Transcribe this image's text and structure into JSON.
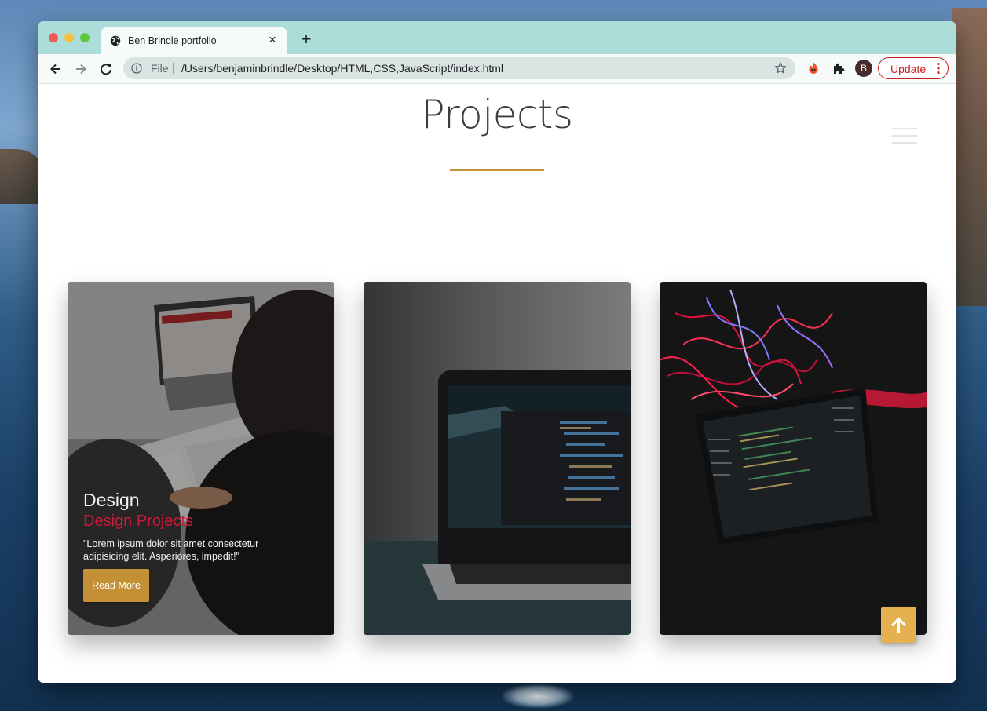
{
  "browser": {
    "tab_title": "Ben Brindle portfolio",
    "new_tab_symbol": "+",
    "close_symbol": "×",
    "url_scheme_label": "File",
    "url": "/Users/benjaminbrindle/Desktop/HTML,CSS,JavaScript/index.html",
    "profile_initial": "B",
    "update_label": "Update"
  },
  "page": {
    "title": "Projects",
    "accent_color": "#c29238"
  },
  "cards": [
    {
      "title": "Design",
      "subtitle": "Design Projects",
      "text": "\"Lorem ipsum dolor sit amet consectetur adipisicing elit. Asperiores, impedit!\"",
      "button_label": "Read More"
    }
  ],
  "icons": {
    "scroll_top": "arrow-up-icon",
    "menu": "hamburger-icon"
  }
}
